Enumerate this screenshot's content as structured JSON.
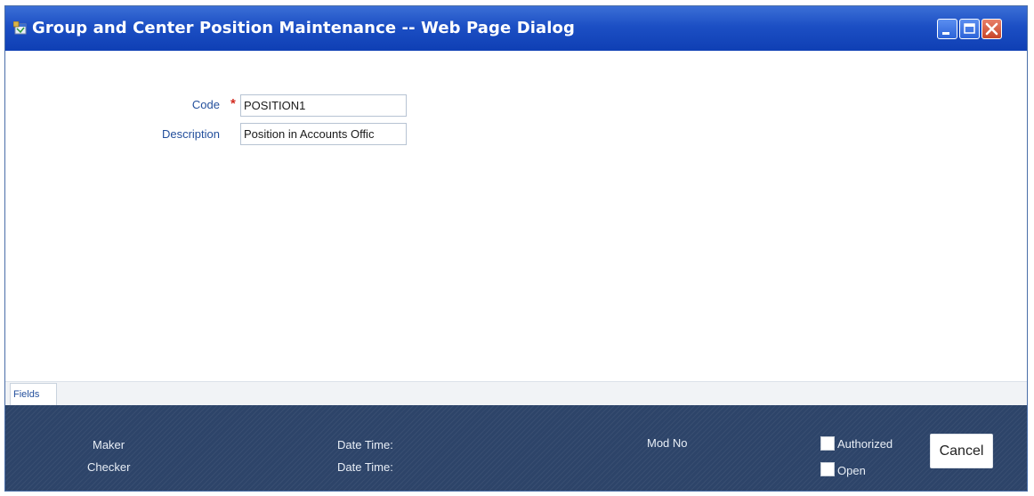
{
  "window": {
    "title": "Group and Center Position Maintenance -- Web Page Dialog",
    "icon": "web-page-dialog-icon",
    "controls": [
      "minimize-icon",
      "maximize-icon",
      "close-icon"
    ]
  },
  "form": {
    "code_label": "Code",
    "code_required_marker": "*",
    "code_value": "POSITION1",
    "description_label": "Description",
    "description_value": "Position in Accounts Offic"
  },
  "tabs": [
    {
      "label": "Fields",
      "selected": true
    }
  ],
  "footer": {
    "maker_label": "Maker",
    "checker_label": "Checker",
    "maker_datetime_label": "Date Time:",
    "checker_datetime_label": "Date Time:",
    "mod_no_label": "Mod No",
    "authorized_label": "Authorized",
    "open_label": "Open",
    "cancel_label": "Cancel"
  },
  "colors": {
    "titlebar": "#1c4fc4",
    "footer": "#2d4469",
    "label_text": "#234f9c",
    "required": "#d22a1f"
  }
}
